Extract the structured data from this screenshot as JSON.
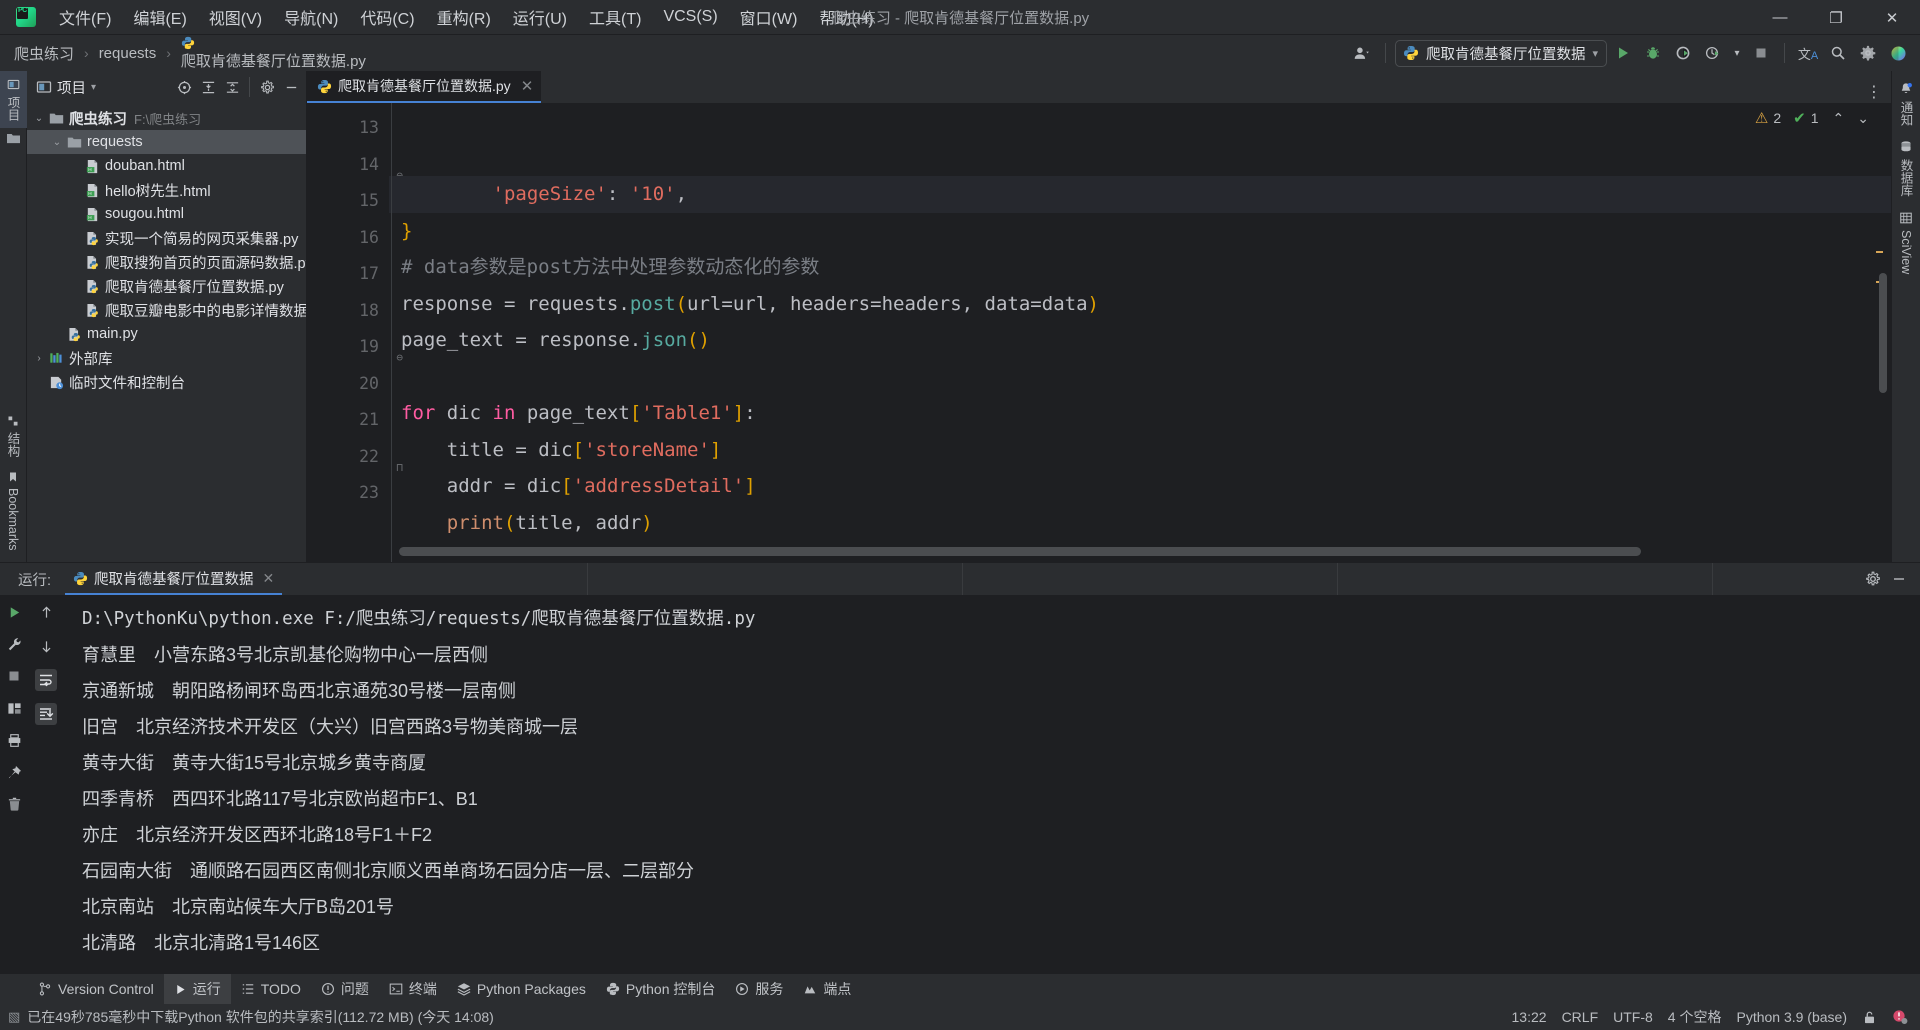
{
  "window": {
    "title": "爬虫练习 - 爬取肯德基餐厅位置数据.py",
    "minimize": "—",
    "maximize": "❐",
    "close": "✕"
  },
  "menu": {
    "items": [
      {
        "label": "文件(F)",
        "name": "menu-file"
      },
      {
        "label": "编辑(E)",
        "name": "menu-edit"
      },
      {
        "label": "视图(V)",
        "name": "menu-view"
      },
      {
        "label": "导航(N)",
        "name": "menu-navigate"
      },
      {
        "label": "代码(C)",
        "name": "menu-code"
      },
      {
        "label": "重构(R)",
        "name": "menu-refactor"
      },
      {
        "label": "运行(U)",
        "name": "menu-run"
      },
      {
        "label": "工具(T)",
        "name": "menu-tools"
      },
      {
        "label": "VCS(S)",
        "name": "menu-vcs"
      },
      {
        "label": "窗口(W)",
        "name": "menu-window"
      },
      {
        "label": "帮助(H)",
        "name": "menu-help"
      }
    ]
  },
  "breadcrumbs": {
    "sep": "›",
    "items": [
      "爬虫练习",
      "requests",
      "爬取肯德基餐厅位置数据.py"
    ]
  },
  "toolbar": {
    "run_config": "爬取肯德基餐厅位置数据",
    "dropdown_caret": "▾",
    "icons": [
      {
        "name": "run-button",
        "glyph": "▶"
      },
      {
        "name": "debug-button",
        "glyph": "🐞"
      },
      {
        "name": "run-coverage-button",
        "glyph": "◐"
      },
      {
        "name": "profile-button",
        "glyph": "◴"
      },
      {
        "name": "stop-button",
        "glyph": "■"
      },
      {
        "name": "translate-button",
        "glyph": "文A"
      },
      {
        "name": "search-everywhere-icon",
        "glyph": "🔍"
      },
      {
        "name": "settings-gear-icon",
        "glyph": "⚙"
      },
      {
        "name": "ide-assistant-icon",
        "glyph": "◕"
      }
    ]
  },
  "left_stripe": {
    "top": [
      {
        "label": "项目",
        "name": "stripe-project",
        "selected": true
      }
    ],
    "bottom": [
      {
        "label": "结构",
        "name": "stripe-structure"
      },
      {
        "label": "Bookmarks",
        "name": "stripe-bookmarks"
      }
    ]
  },
  "right_stripe": {
    "items": [
      {
        "label": "通知",
        "name": "stripe-notifications"
      },
      {
        "label": "数据库",
        "name": "stripe-database"
      },
      {
        "label": "SciView",
        "name": "stripe-sciview"
      }
    ]
  },
  "project_panel": {
    "title": "项目",
    "caret": "▾",
    "header_icons": [
      {
        "name": "select-opened-file-icon",
        "glyph": "⊕"
      },
      {
        "name": "expand-all-icon",
        "glyph": "⬍"
      },
      {
        "name": "collapse-all-icon",
        "glyph": "⬌"
      },
      {
        "name": "project-settings-icon",
        "glyph": "⚙"
      },
      {
        "name": "hide-panel-icon",
        "glyph": "—"
      }
    ],
    "tree": [
      {
        "name": "tree-node-project-root",
        "label": "爬虫练习",
        "path": "F:\\爬虫练习",
        "indent": 0,
        "arrow": "⌄",
        "icon": "folder",
        "selected": false,
        "bold": true
      },
      {
        "name": "tree-node-requests",
        "label": "requests",
        "path": "",
        "indent": 1,
        "arrow": "⌄",
        "icon": "folder",
        "selected": true,
        "bold": false
      },
      {
        "name": "tree-node-douban-html",
        "label": "douban.html",
        "path": "",
        "indent": 2,
        "arrow": "",
        "icon": "html",
        "selected": false,
        "bold": false
      },
      {
        "name": "tree-node-hello-html",
        "label": "hello树先生.html",
        "path": "",
        "indent": 2,
        "arrow": "",
        "icon": "html",
        "selected": false,
        "bold": false
      },
      {
        "name": "tree-node-sougou-html",
        "label": "sougou.html",
        "path": "",
        "indent": 2,
        "arrow": "",
        "icon": "html",
        "selected": false,
        "bold": false
      },
      {
        "name": "tree-node-collector-py",
        "label": "实现一个简易的网页采集器.py",
        "path": "",
        "indent": 2,
        "arrow": "",
        "icon": "py",
        "selected": false,
        "bold": false
      },
      {
        "name": "tree-node-sogou-source-py",
        "label": "爬取搜狗首页的页面源码数据.py",
        "path": "",
        "indent": 2,
        "arrow": "",
        "icon": "py",
        "selected": false,
        "bold": false
      },
      {
        "name": "tree-node-kfc-py",
        "label": "爬取肯德基餐厅位置数据.py",
        "path": "",
        "indent": 2,
        "arrow": "",
        "icon": "py",
        "selected": false,
        "bold": false
      },
      {
        "name": "tree-node-douban-movie-py",
        "label": "爬取豆瓣电影中的电影详情数据.py",
        "path": "",
        "indent": 2,
        "arrow": "",
        "icon": "py",
        "selected": false,
        "bold": false
      },
      {
        "name": "tree-node-main-py",
        "label": "main.py",
        "path": "",
        "indent": 1,
        "arrow": "",
        "icon": "py",
        "selected": false,
        "bold": false
      },
      {
        "name": "tree-node-external-libraries",
        "label": "外部库",
        "path": "",
        "indent": 0,
        "arrow": "›",
        "icon": "lib",
        "selected": false,
        "bold": false
      },
      {
        "name": "tree-node-scratches",
        "label": "临时文件和控制台",
        "path": "",
        "indent": 0,
        "arrow": "",
        "icon": "scratch",
        "selected": false,
        "bold": false
      }
    ]
  },
  "editor": {
    "tab_label": "爬取肯德基餐厅位置数据.py",
    "tab_close": "✕",
    "more_icon": "⋮",
    "inspection": {
      "warning_glyph": "⚠",
      "warning_count": "2",
      "ok_glyph": "✔",
      "ok_count": "1",
      "up_glyph": "⌃",
      "down_glyph": "⌄"
    },
    "lines": [
      {
        "number": "13",
        "fold": "",
        "current": true,
        "tokens": [
          {
            "t": "        ",
            "c": "pl"
          },
          {
            "t": "'pageSize'",
            "c": "str"
          },
          {
            "t": ":",
            "c": "pl"
          },
          {
            "t": " ",
            "c": "pl"
          },
          {
            "t": "'10'",
            "c": "str"
          },
          {
            "t": ",",
            "c": "pl"
          }
        ]
      },
      {
        "number": "14",
        "fold": "⊖",
        "current": false,
        "tokens": [
          {
            "t": "}",
            "c": "br"
          }
        ]
      },
      {
        "number": "15",
        "fold": "",
        "current": false,
        "tokens": [
          {
            "t": "# data参数是post方法中处理参数动态化的参数",
            "c": "com"
          }
        ]
      },
      {
        "number": "16",
        "fold": "",
        "current": false,
        "tokens": [
          {
            "t": "response ",
            "c": "pl"
          },
          {
            "t": "= ",
            "c": "pl"
          },
          {
            "t": "requests",
            "c": "pl"
          },
          {
            "t": ".",
            "c": "pl"
          },
          {
            "t": "post",
            "c": "fn"
          },
          {
            "t": "(",
            "c": "br"
          },
          {
            "t": "url",
            "c": "pl"
          },
          {
            "t": "=",
            "c": "pl"
          },
          {
            "t": "url",
            "c": "pl"
          },
          {
            "t": ", ",
            "c": "pl"
          },
          {
            "t": "headers",
            "c": "pl"
          },
          {
            "t": "=",
            "c": "pl"
          },
          {
            "t": "headers",
            "c": "pl"
          },
          {
            "t": ", ",
            "c": "pl"
          },
          {
            "t": "data",
            "c": "pl"
          },
          {
            "t": "=",
            "c": "pl"
          },
          {
            "t": "data",
            "c": "pl"
          },
          {
            "t": ")",
            "c": "br"
          }
        ]
      },
      {
        "number": "17",
        "fold": "",
        "current": false,
        "tokens": [
          {
            "t": "page_text ",
            "c": "pl"
          },
          {
            "t": "= ",
            "c": "pl"
          },
          {
            "t": "response",
            "c": "pl"
          },
          {
            "t": ".",
            "c": "pl"
          },
          {
            "t": "json",
            "c": "fn"
          },
          {
            "t": "()",
            "c": "br"
          }
        ]
      },
      {
        "number": "18",
        "fold": "",
        "current": false,
        "tokens": []
      },
      {
        "number": "19",
        "fold": "⊖",
        "current": false,
        "tokens": [
          {
            "t": "for",
            "c": "kw2"
          },
          {
            "t": " dic ",
            "c": "pl"
          },
          {
            "t": "in",
            "c": "kw2"
          },
          {
            "t": " page_text",
            "c": "pl"
          },
          {
            "t": "[",
            "c": "br"
          },
          {
            "t": "'Table1'",
            "c": "str"
          },
          {
            "t": "]",
            "c": "br"
          },
          {
            "t": ":",
            "c": "pl"
          }
        ]
      },
      {
        "number": "20",
        "fold": "",
        "current": false,
        "tokens": [
          {
            "t": "    title ",
            "c": "pl"
          },
          {
            "t": "= ",
            "c": "pl"
          },
          {
            "t": "dic",
            "c": "pl"
          },
          {
            "t": "[",
            "c": "br"
          },
          {
            "t": "'storeName'",
            "c": "str"
          },
          {
            "t": "]",
            "c": "br"
          }
        ]
      },
      {
        "number": "21",
        "fold": "",
        "current": false,
        "tokens": [
          {
            "t": "    addr ",
            "c": "pl"
          },
          {
            "t": "= ",
            "c": "pl"
          },
          {
            "t": "dic",
            "c": "pl"
          },
          {
            "t": "[",
            "c": "br"
          },
          {
            "t": "'addressDetail'",
            "c": "str"
          },
          {
            "t": "]",
            "c": "br"
          }
        ]
      },
      {
        "number": "22",
        "fold": "⊓",
        "current": false,
        "tokens": [
          {
            "t": "    ",
            "c": "pl"
          },
          {
            "t": "print",
            "c": "kw"
          },
          {
            "t": "(",
            "c": "br"
          },
          {
            "t": "title",
            "c": "pl"
          },
          {
            "t": ", ",
            "c": "pl"
          },
          {
            "t": "addr",
            "c": "pl"
          },
          {
            "t": ")",
            "c": "br"
          }
        ]
      },
      {
        "number": "23",
        "fold": "",
        "current": false,
        "tokens": []
      }
    ]
  },
  "run_panel": {
    "label": "运行:",
    "tab_label": "爬取肯德基餐厅位置数据",
    "tab_close": "✕",
    "header_icons": [
      {
        "name": "run-panel-settings-icon",
        "glyph": "⚙"
      },
      {
        "name": "run-panel-hide-icon",
        "glyph": "—"
      }
    ],
    "side_icons": [
      {
        "name": "rerun-button",
        "glyph": "▶"
      },
      {
        "name": "wrench-icon",
        "glyph": "🔧"
      },
      {
        "name": "stop-process-button",
        "glyph": "■"
      },
      {
        "name": "print-icon",
        "glyph": "⎙"
      },
      {
        "name": "pin-tab-icon",
        "glyph": "📌"
      },
      {
        "name": "clear-all-icon",
        "glyph": "🗑"
      }
    ],
    "nav_icons": [
      {
        "name": "up-the-stack-trace-icon",
        "glyph": "↑"
      },
      {
        "name": "down-the-stack-trace-icon",
        "glyph": "↓"
      },
      {
        "name": "soft-wrap-icon",
        "glyph": "↩"
      },
      {
        "name": "scroll-to-end-icon",
        "glyph": "⇣"
      }
    ],
    "command": "D:\\PythonKu\\python.exe F:/爬虫练习/requests/爬取肯德基餐厅位置数据.py",
    "output": [
      "育慧里 小营东路3号北京凯基伦购物中心一层西侧",
      "京通新城 朝阳路杨闸环岛西北京通苑30号楼一层南侧",
      "旧宫 北京经济技术开发区（大兴）旧宫西路3号物美商城一层",
      "黄寺大街 黄寺大街15号北京城乡黄寺商厦",
      "四季青桥 西四环北路117号北京欧尚超市F1、B1",
      "亦庄 北京经济开发区西环北路18号F1＋F2",
      "石园南大街 通顺路石园西区南侧北京顺义西单商场石园分店一层、二层部分",
      "北京南站 北京南站候车大厅B岛201号",
      "北清路 北京北清路1号146区"
    ]
  },
  "tool_window_bar": {
    "items": [
      {
        "label": "Version Control",
        "name": "toolwindow-version-control",
        "icon": "branch",
        "selected": false
      },
      {
        "label": "运行",
        "name": "toolwindow-run",
        "icon": "play",
        "selected": true
      },
      {
        "label": "TODO",
        "name": "toolwindow-todo",
        "icon": "list",
        "selected": false
      },
      {
        "label": "问题",
        "name": "toolwindow-problems",
        "icon": "exclaim",
        "selected": false
      },
      {
        "label": "终端",
        "name": "toolwindow-terminal",
        "icon": "terminal",
        "selected": false
      },
      {
        "label": "Python Packages",
        "name": "toolwindow-python-packages",
        "icon": "packages",
        "selected": false
      },
      {
        "label": "Python 控制台",
        "name": "toolwindow-python-console",
        "icon": "python",
        "selected": false
      },
      {
        "label": "服务",
        "name": "toolwindow-services",
        "icon": "services",
        "selected": false
      },
      {
        "label": "端点",
        "name": "toolwindow-endpoints",
        "icon": "endpoints",
        "selected": false
      }
    ]
  },
  "status_bar": {
    "message": "已在49秒785毫秒中下载Python 软件包的共享索引(112.72 MB) (今天 14:08)",
    "message_icon": "▧",
    "position": "13:22",
    "line_separator": "CRLF",
    "encoding": "UTF-8",
    "indent": "4 个空格",
    "interpreter": "Python 3.9 (base)",
    "lock_icon": "🔓",
    "notification_icon": "❗"
  }
}
